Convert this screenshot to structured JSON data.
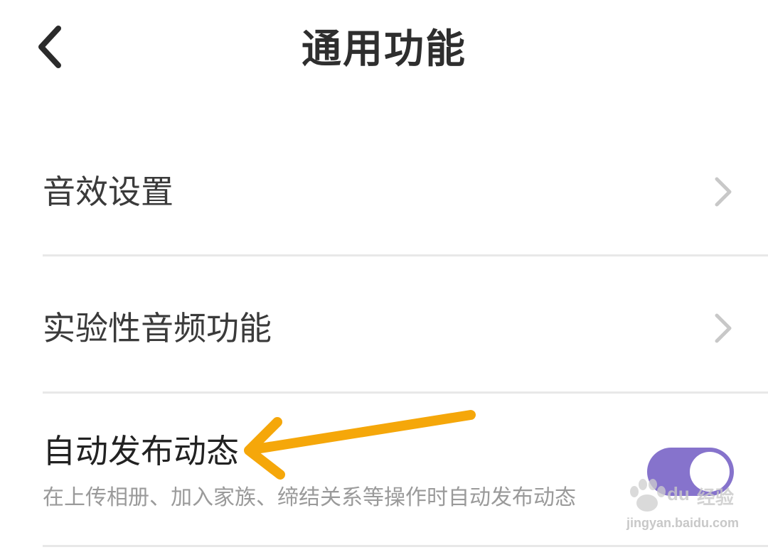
{
  "header": {
    "title": "通用功能"
  },
  "settings": {
    "items": [
      {
        "label": "音效设置",
        "icon": "chevron-right-icon"
      },
      {
        "label": "实验性音频功能",
        "icon": "chevron-right-icon"
      },
      {
        "label": "自动发布动态",
        "description": "在上传相册、加入家族、缔结关系等操作时自动发布动态",
        "toggle_on": true
      }
    ]
  },
  "colors": {
    "toggle_accent": "#8673cc",
    "annotation_arrow": "#f5a70a"
  },
  "watermark": {
    "logo_text": "Bai",
    "logo_text_2": "du",
    "logo_cn": "经验",
    "url": "jingyan.baidu.com"
  }
}
